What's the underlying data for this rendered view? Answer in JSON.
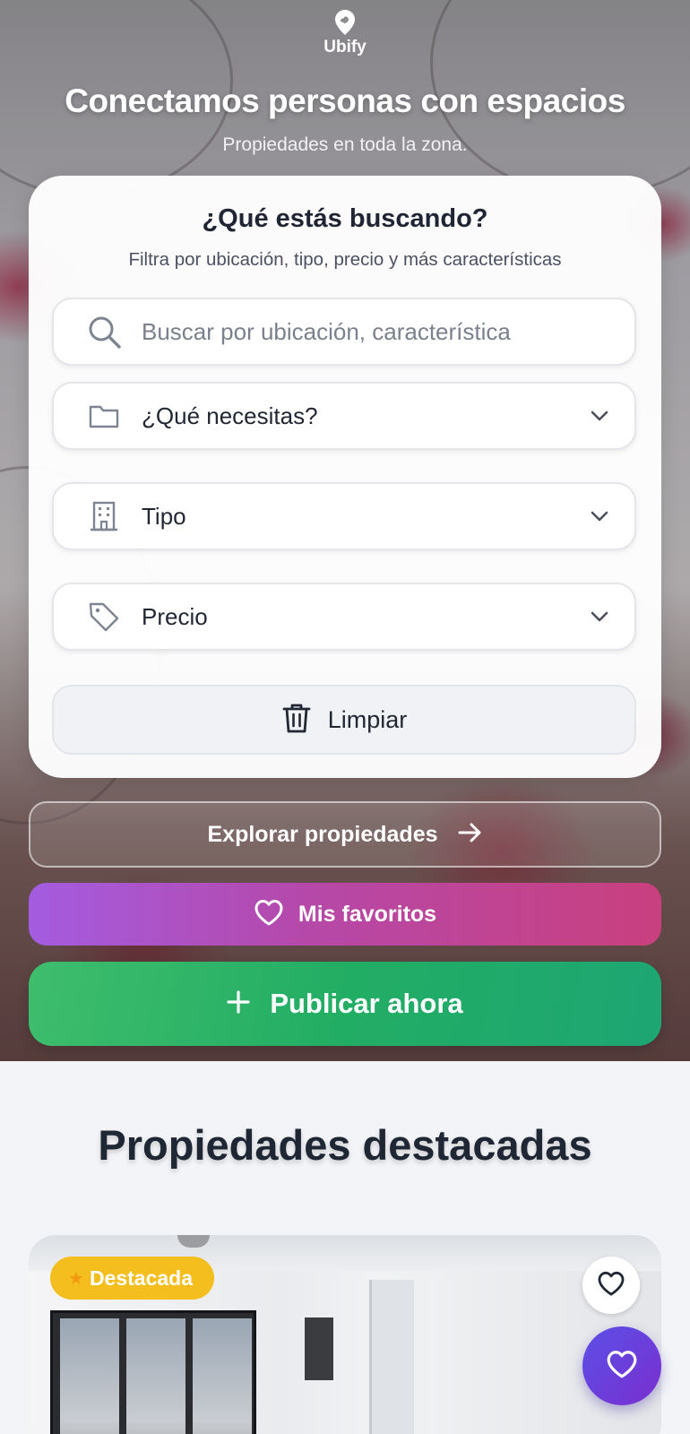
{
  "brand": {
    "name": "Ubify",
    "icon": "map-pin-icon"
  },
  "hero": {
    "headline": "Conectamos personas con espacios",
    "subheadline": "Propiedades en toda la zona."
  },
  "search_card": {
    "title": "¿Qué estás buscando?",
    "subtitle": "Filtra por ubicación, tipo, precio y más características",
    "search": {
      "placeholder": "Buscar por ubicación, característica",
      "icon": "search-icon"
    },
    "need_select": {
      "value": "¿Qué necesitas?",
      "icon": "folder-icon"
    },
    "type_select": {
      "value": "Tipo",
      "icon": "building-icon"
    },
    "price_select": {
      "value": "Precio",
      "icon": "tag-icon"
    },
    "clear_label": "Limpiar"
  },
  "actions": {
    "explore_label": "Explorar propiedades",
    "favorites_label": "Mis favoritos",
    "publish_label": "Publicar ahora"
  },
  "featured": {
    "title": "Propiedades destacadas",
    "cards": [
      {
        "badge": "Destacada",
        "badge_icon": "star-icon"
      }
    ]
  },
  "colors": {
    "favorites_gradient": [
      "#a45ce0",
      "#c9407e"
    ],
    "publish_gradient": [
      "#3ebd6c",
      "#1ea673"
    ],
    "badge": "#f4be1e",
    "fab": "#5b4fe6",
    "text_dark": "#1f2533"
  }
}
